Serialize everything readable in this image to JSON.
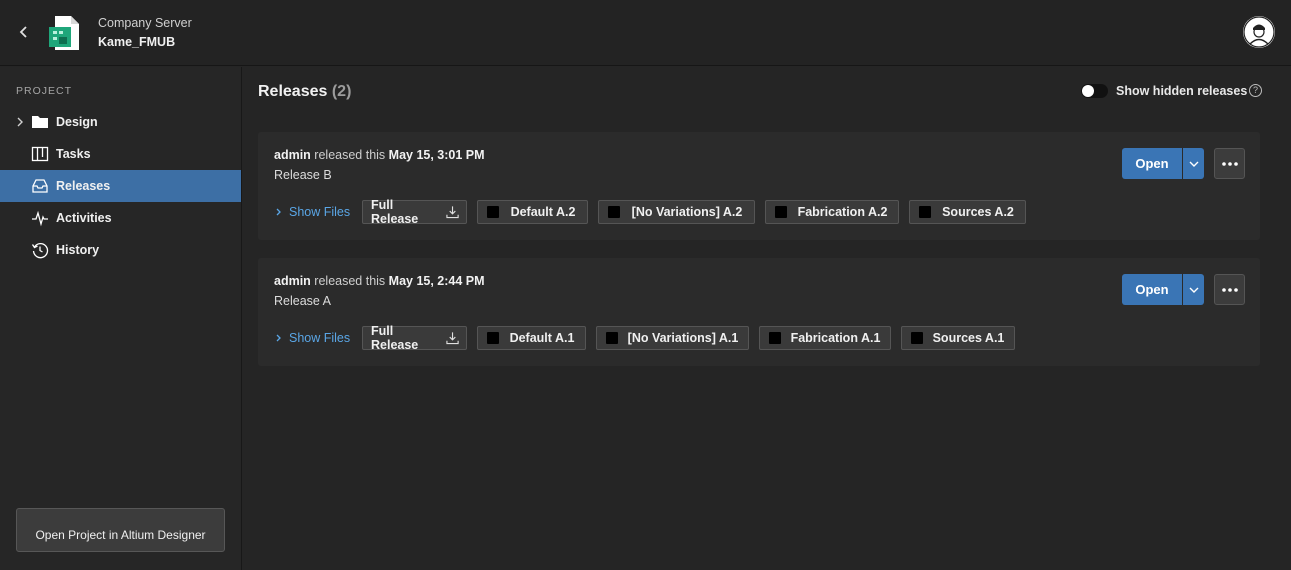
{
  "header": {
    "server_name": "Company Server",
    "project_name": "Kame_FMUB",
    "icons": {
      "back": "chevron-left-icon",
      "project": "pcb-project-icon",
      "avatar": "user-avatar-icon"
    }
  },
  "sidebar": {
    "section_label": "PROJECT",
    "items": [
      {
        "label": "Design",
        "icon": "folder-icon",
        "expandable": true,
        "active": false
      },
      {
        "label": "Tasks",
        "icon": "tasks-board-icon",
        "active": false
      },
      {
        "label": "Releases",
        "icon": "releases-tray-icon",
        "active": true
      },
      {
        "label": "Activities",
        "icon": "activity-pulse-icon",
        "active": false
      },
      {
        "label": "History",
        "icon": "history-clock-icon",
        "active": false
      }
    ],
    "open_button": "Open Project in Altium Designer"
  },
  "main": {
    "title": "Releases",
    "count": "(2)",
    "toggle_label": "Show hidden releases",
    "toggle_on": false,
    "help_glyph": "?",
    "releases": [
      {
        "user": "admin",
        "action": "released this",
        "date": "May 15, 3:01 PM",
        "name": "Release B",
        "show_files": "Show Files",
        "full_release": "Full Release",
        "packages": [
          "Default A.2",
          "[No Variations] A.2",
          "Fabrication A.2",
          "Sources A.2"
        ],
        "open_label": "Open"
      },
      {
        "user": "admin",
        "action": "released this",
        "date": "May 15, 2:44 PM",
        "name": "Release A",
        "show_files": "Show Files",
        "full_release": "Full Release",
        "packages": [
          "Default A.1",
          "[No Variations] A.1",
          "Fabrication A.1",
          "Sources A.1"
        ],
        "open_label": "Open"
      }
    ]
  },
  "colors": {
    "accent": "#3a75b5",
    "active_nav": "#3d6fa5",
    "link": "#5aa6e6",
    "background": "#252525"
  }
}
